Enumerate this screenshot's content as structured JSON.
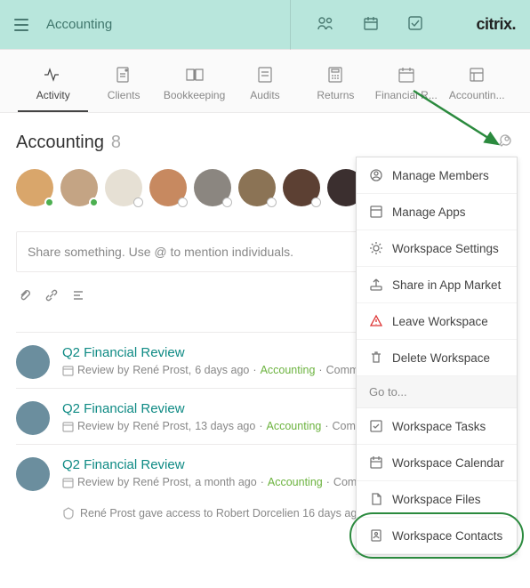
{
  "topbar": {
    "title": "Accounting",
    "logo": "citrix."
  },
  "tabs": [
    {
      "label": "Activity"
    },
    {
      "label": "Clients"
    },
    {
      "label": "Bookkeeping"
    },
    {
      "label": "Audits"
    },
    {
      "label": "Returns"
    },
    {
      "label": "Financial R..."
    },
    {
      "label": "Accountin..."
    }
  ],
  "section": {
    "title": "Accounting",
    "count": "8"
  },
  "avatars": [
    {
      "color": "#d9a66b",
      "status": "online"
    },
    {
      "color": "#c4a484",
      "status": "online"
    },
    {
      "color": "#e6e0d4",
      "status": "off"
    },
    {
      "color": "#c78960",
      "status": "off"
    },
    {
      "color": "#8b8680",
      "status": "off"
    },
    {
      "color": "#8b7355",
      "status": "off"
    },
    {
      "color": "#5c4033",
      "status": "off"
    },
    {
      "color": "#3b2f2f",
      "status": "off"
    }
  ],
  "compose": {
    "placeholder": "Share something. Use @ to mention individuals."
  },
  "feed": [
    {
      "title": "Q2 Financial Review",
      "meta_app": "Review",
      "meta_by": "by",
      "meta_author": "René Prost,",
      "meta_time": "6 days ago",
      "link": "Accounting",
      "action": "Comment",
      "avatar": "#6b8e9e"
    },
    {
      "title": "Q2 Financial Review",
      "meta_app": "Review",
      "meta_by": "by",
      "meta_author": "René Prost,",
      "meta_time": "13 days ago",
      "link": "Accounting",
      "action": "Comment",
      "avatar": "#6b8e9e"
    },
    {
      "title": "Q2 Financial Review",
      "meta_app": "Review",
      "meta_by": "by",
      "meta_author": "René Prost,",
      "meta_time": "a month ago",
      "link": "Accounting",
      "actions": "Comment · Like · Task",
      "avatar": "#6b8e9e"
    }
  ],
  "sub_activity": "René Prost gave access to Robert Dorcelien  16 days ago",
  "dropdown": {
    "items": [
      {
        "label": "Manage Members"
      },
      {
        "label": "Manage Apps"
      },
      {
        "label": "Workspace Settings"
      },
      {
        "label": "Share in App Market"
      },
      {
        "label": "Leave Workspace"
      },
      {
        "label": "Delete Workspace"
      }
    ],
    "header": "Go to...",
    "goto": [
      {
        "label": "Workspace Tasks"
      },
      {
        "label": "Workspace Calendar"
      },
      {
        "label": "Workspace Files"
      },
      {
        "label": "Workspace Contacts"
      }
    ]
  }
}
